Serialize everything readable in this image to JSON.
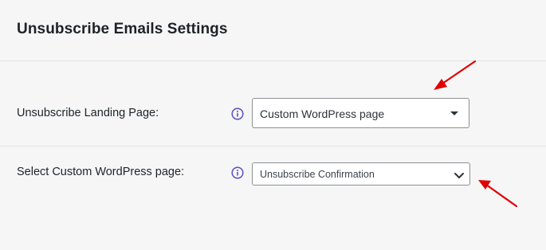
{
  "header": {
    "title": "Unsubscribe Emails Settings"
  },
  "settings": {
    "landing_page": {
      "label": "Unsubscribe Landing Page:",
      "selected": "Custom WordPress page"
    },
    "custom_page": {
      "label": "Select Custom WordPress page:",
      "selected": "Unsubscribe Confirmation"
    }
  },
  "icons": {
    "info": "info-circle-icon",
    "annotation_arrow": "red-arrow-annotation"
  },
  "colors": {
    "info_icon": "#5b4fc7",
    "annotation": "#e00000",
    "background": "#f6f6f7"
  }
}
